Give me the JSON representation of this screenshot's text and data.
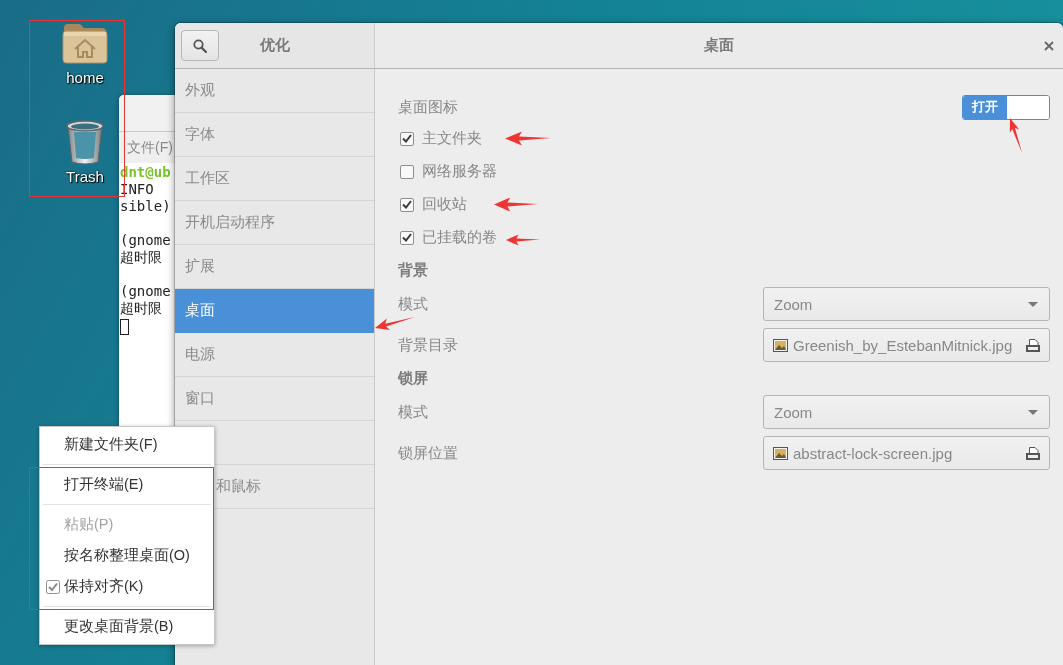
{
  "desktop": {
    "icons": [
      {
        "kind": "home-folder",
        "label": "home"
      },
      {
        "kind": "trash",
        "label": "Trash"
      }
    ]
  },
  "terminal": {
    "menu": [
      "文件(F)"
    ],
    "lines": [
      {
        "kind": "prompt",
        "text": "dnt@ub"
      },
      {
        "kind": "output",
        "text": "INFO"
      },
      {
        "kind": "output",
        "text": "sible)"
      },
      {
        "kind": "blank"
      },
      {
        "kind": "output",
        "text": "(gnome"
      },
      {
        "kind": "output",
        "text": "超时限"
      },
      {
        "kind": "blank"
      },
      {
        "kind": "output",
        "text": "(gnome"
      },
      {
        "kind": "output",
        "text": "超时限"
      },
      {
        "kind": "cursor"
      }
    ]
  },
  "tweaks_window": {
    "header": {
      "sidebar_title": "优化",
      "title": "桌面"
    },
    "sidebar": {
      "items": [
        {
          "kind": "item",
          "label": "外观",
          "selected": false
        },
        {
          "kind": "item",
          "label": "字体",
          "selected": false
        },
        {
          "kind": "item",
          "label": "工作区",
          "selected": false
        },
        {
          "kind": "item",
          "label": "开机启动程序",
          "selected": false
        },
        {
          "kind": "item",
          "label": "扩展",
          "selected": false
        },
        {
          "kind": "item",
          "label": "桌面",
          "selected": true
        },
        {
          "kind": "item",
          "label": "电源",
          "selected": false
        },
        {
          "kind": "item",
          "label": "窗口",
          "selected": false
        },
        {
          "kind": "covered",
          "selected": false
        },
        {
          "kind": "partly-covered",
          "label": "和鼠标",
          "selected": false
        }
      ]
    },
    "desktop_icons": {
      "label": "桌面图标",
      "toggle": {
        "label": "打开",
        "on": true
      },
      "checkboxes": [
        {
          "label": "主文件夹",
          "checked": true
        },
        {
          "label": "网络服务器",
          "checked": false
        },
        {
          "label": "回收站",
          "checked": true
        },
        {
          "label": "已挂载的卷",
          "checked": true
        }
      ]
    },
    "sections": [
      {
        "heading": "背景",
        "rows": [
          {
            "kind": "dropdown",
            "label": "模式",
            "value": "Zoom"
          },
          {
            "kind": "file",
            "label": "背景目录",
            "value": "Greenish_by_EstebanMitnick.jpg"
          }
        ]
      },
      {
        "heading": "锁屏",
        "rows": [
          {
            "kind": "dropdown",
            "label": "模式",
            "value": "Zoom"
          },
          {
            "kind": "file",
            "label": "锁屏位置",
            "value": "abstract-lock-screen.jpg"
          }
        ]
      }
    ]
  },
  "context_menu": {
    "groups": [
      [
        {
          "kind": "action",
          "label": "新建文件夹(F)",
          "disabled": false
        }
      ],
      [
        {
          "kind": "action",
          "label": "打开终端(E)",
          "disabled": false
        }
      ],
      [
        {
          "kind": "action",
          "label": "粘贴(P)",
          "disabled": true
        },
        {
          "kind": "action",
          "label": "按名称整理桌面(O)",
          "disabled": false
        },
        {
          "kind": "check",
          "label": "保持对齐(K)",
          "checked": true,
          "disabled": false
        }
      ],
      [
        {
          "kind": "action",
          "label": "更改桌面背景(B)",
          "disabled": false
        }
      ]
    ]
  }
}
